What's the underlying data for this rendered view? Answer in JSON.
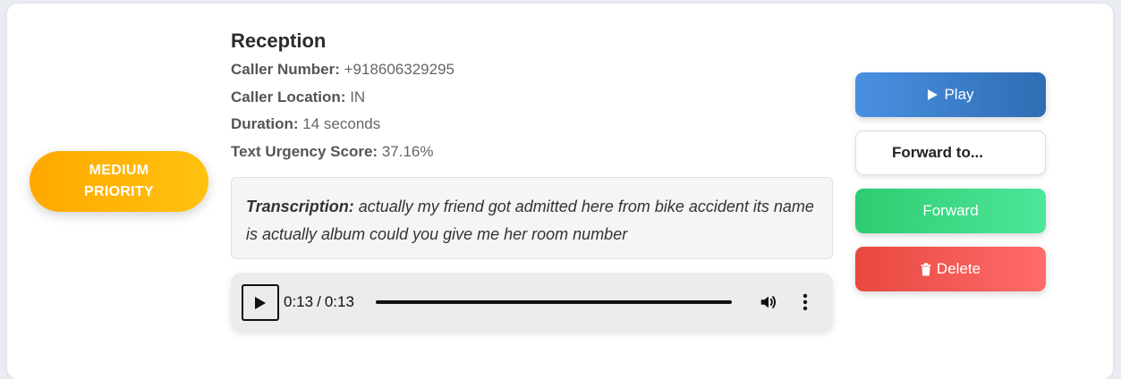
{
  "priority_badge": {
    "line1": "MEDIUM",
    "line2": "PRIORITY",
    "color": "#ffb300"
  },
  "call": {
    "title": "Reception",
    "caller_number_label": "Caller Number:",
    "caller_number": "+918606329295",
    "caller_location_label": "Caller Location:",
    "caller_location": "IN",
    "duration_label": "Duration:",
    "duration": "14 seconds",
    "urgency_label": "Text Urgency Score:",
    "urgency": "37.16%"
  },
  "transcription": {
    "label": "Transcription:",
    "text": "actually my friend got admitted here from bike accident its name is actually album could you give me her room number"
  },
  "audio_player": {
    "current_time": "0:13",
    "separator": "/",
    "total_time": "0:13",
    "progress_fraction": 1.0,
    "play_icon": "play-icon",
    "volume_icon": "volume-icon",
    "menu_icon": "more-vertical-icon"
  },
  "actions": {
    "play_label": "Play",
    "play_icon": "play-triangle-icon",
    "forward_to_label": "Forward to...",
    "forward_label": "Forward",
    "delete_label": "Delete",
    "delete_icon": "trash-icon",
    "colors": {
      "play": "#3f82d6",
      "forward": "#3dd884",
      "delete": "#f05a52"
    }
  }
}
